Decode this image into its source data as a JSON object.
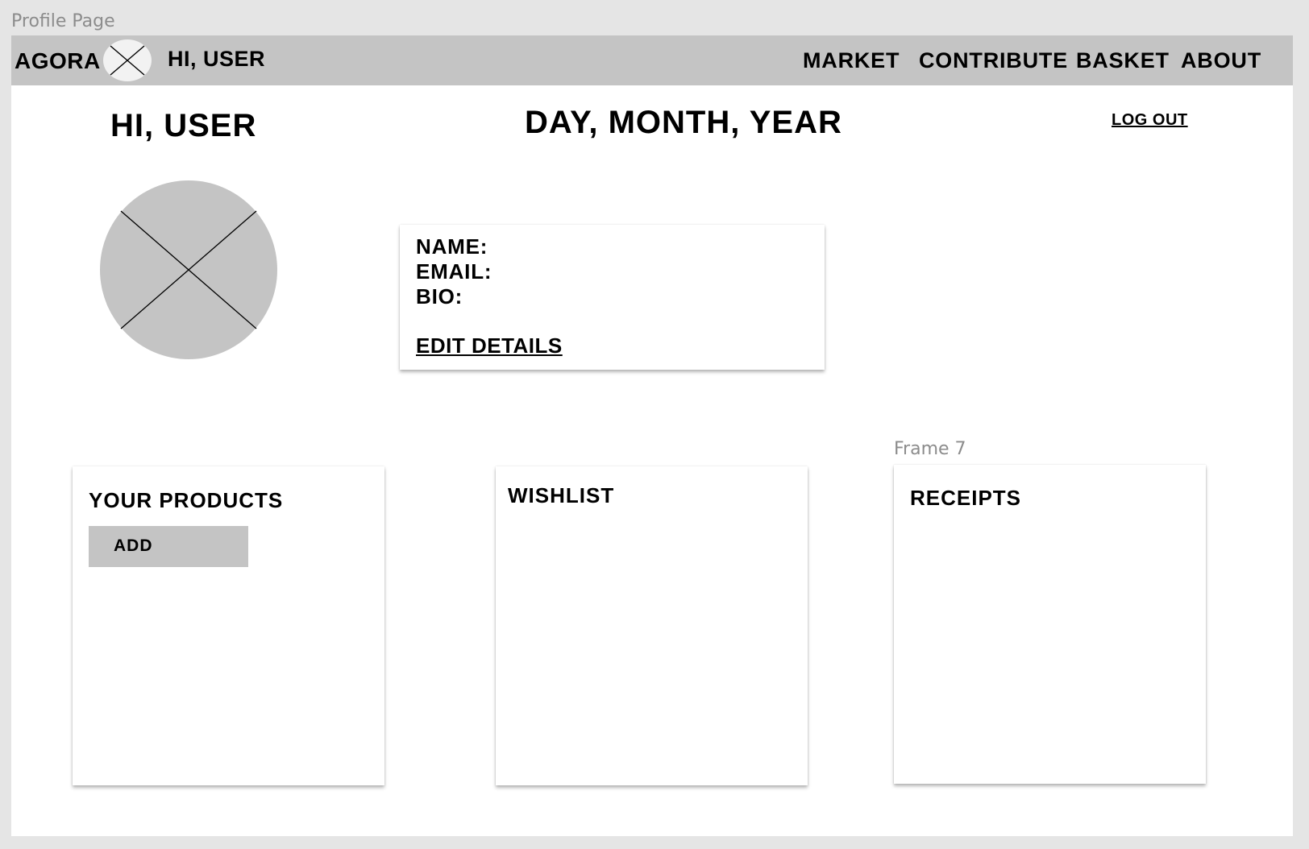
{
  "canvas": {
    "page_label": "Profile Page",
    "frame_label": "Frame 7"
  },
  "navbar": {
    "brand": "AGORA",
    "logo_icon": "logo-placeholder-icon",
    "greeting": "HI, USER",
    "links": [
      {
        "label": "MARKET"
      },
      {
        "label": "CONTRIBUTE"
      },
      {
        "label": "BASKET"
      },
      {
        "label": "ABOUT"
      }
    ],
    "background_color": "#c4c4c4"
  },
  "header": {
    "greeting": "HI, USER",
    "date": "DAY, MONTH, YEAR",
    "logout_label": "LOG OUT"
  },
  "profile": {
    "avatar_icon": "avatar-placeholder-icon",
    "fields": [
      {
        "label": "NAME:"
      },
      {
        "label": "EMAIL:"
      },
      {
        "label": "BIO:"
      }
    ],
    "edit_label": "EDIT DETAILS"
  },
  "sections": {
    "products": {
      "title": "YOUR PRODUCTS",
      "add_label": "ADD"
    },
    "wishlist": {
      "title": "WISHLIST"
    },
    "receipts": {
      "title": "RECEIPTS"
    }
  },
  "colors": {
    "placeholder_gray": "#c4c4c4",
    "canvas_background": "#e5e5e5",
    "label_gray": "#8c8c8c"
  }
}
